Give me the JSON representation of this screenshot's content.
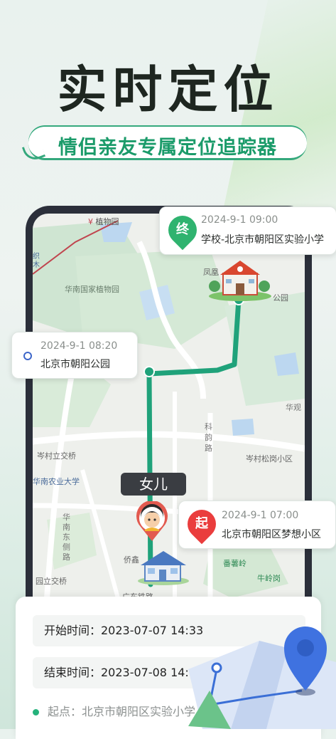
{
  "hero": {
    "title": "实时定位",
    "subtitle": "情侣亲友专属定位追踪器"
  },
  "map": {
    "place_labels": {
      "botanical": "植物园",
      "botanical_main": "华南国家植物园",
      "fenghuang": "凤凰",
      "park": "公园",
      "huaguan": "华观",
      "kejun_road": "科韵路",
      "cencun_bridge": "岑村立交桥",
      "cencun_community": "岑村松岗小区",
      "agri_univ": "华南农业大学",
      "huanan_east_rd": "华南东侧路",
      "qiaoxin": "侨鑫",
      "fanshuling": "番薯岭",
      "niulinggang": "牛岭岗",
      "liyi_bridge": "园立交桥",
      "guangzhou_rail": "广东铁路",
      "left_edge": "织木"
    },
    "route_color": "#1fa27a"
  },
  "cards": {
    "end": {
      "badge": "终",
      "datetime": "2024-9-1   09:00",
      "address": "学校-北京市朝阳区实验小学",
      "badge_color": "#2fb36f"
    },
    "middle": {
      "datetime": "2024-9-1   08:20",
      "address": "北京市朝阳公园"
    },
    "start": {
      "badge": "起",
      "datetime": "2024-9-1   07:00",
      "address": "北京市朝阳区梦想小区",
      "badge_color": "#ea3d3d"
    }
  },
  "person": {
    "label": "女儿"
  },
  "panel": {
    "start_time": "开始时间：2023-07-07 14:33",
    "end_time": "结束时间：2023-07-08 14:",
    "start_point": "起点：北京市朝阳区实验小学"
  }
}
